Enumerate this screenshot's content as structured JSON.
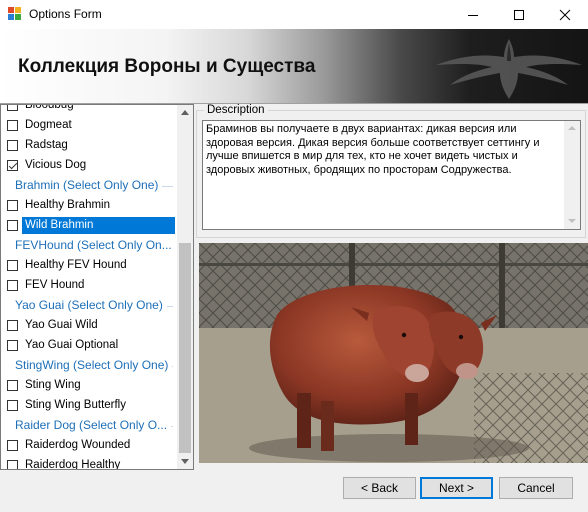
{
  "window": {
    "title": "Options Form"
  },
  "banner": {
    "title": "Коллекция Вороны и Существа"
  },
  "list": {
    "items": [
      {
        "type": "option",
        "label": "Bloodbug",
        "checked": false,
        "selected": false
      },
      {
        "type": "option",
        "label": "Dogmeat",
        "checked": false,
        "selected": false
      },
      {
        "type": "option",
        "label": "Radstag",
        "checked": false,
        "selected": false
      },
      {
        "type": "option",
        "label": "Vicious Dog",
        "checked": true,
        "selected": false
      },
      {
        "type": "group",
        "label": "Brahmin (Select Only One)"
      },
      {
        "type": "option",
        "label": "Healthy Brahmin",
        "checked": false,
        "selected": false
      },
      {
        "type": "option",
        "label": "Wild Brahmin",
        "checked": false,
        "selected": true
      },
      {
        "type": "group",
        "label": "FEVHound (Select Only On..."
      },
      {
        "type": "option",
        "label": "Healthy FEV Hound",
        "checked": false,
        "selected": false
      },
      {
        "type": "option",
        "label": "FEV Hound",
        "checked": false,
        "selected": false
      },
      {
        "type": "group",
        "label": "Yao Guai (Select Only One)"
      },
      {
        "type": "option",
        "label": "Yao Guai Wild",
        "checked": false,
        "selected": false
      },
      {
        "type": "option",
        "label": "Yao Guai Optional",
        "checked": false,
        "selected": false
      },
      {
        "type": "group",
        "label": "StingWing (Select Only One)"
      },
      {
        "type": "option",
        "label": "Sting Wing",
        "checked": false,
        "selected": false
      },
      {
        "type": "option",
        "label": "Sting Wing Butterfly",
        "checked": false,
        "selected": false
      },
      {
        "type": "group",
        "label": "Raider Dog (Select Only O..."
      },
      {
        "type": "option",
        "label": "Raiderdog Wounded",
        "checked": false,
        "selected": false
      },
      {
        "type": "option",
        "label": "Raiderdog Healthy",
        "checked": false,
        "selected": false
      }
    ]
  },
  "description": {
    "legend": "Description",
    "text": "Браминов вы получаете в двух вариантах: дикая версия или здоровая версия. Дикая версия больше соответствует сеттингу и лучше впишется в мир для тех, кто не хочет видеть чистых и здоровых животных, бродящих по просторам Содружества."
  },
  "preview": {
    "subject": "two-headed-brahmin"
  },
  "buttons": {
    "back": "< Back",
    "next": "Next >",
    "cancel": "Cancel"
  },
  "colors": {
    "selection": "#0078d7",
    "group_text": "#1d6fb8"
  }
}
